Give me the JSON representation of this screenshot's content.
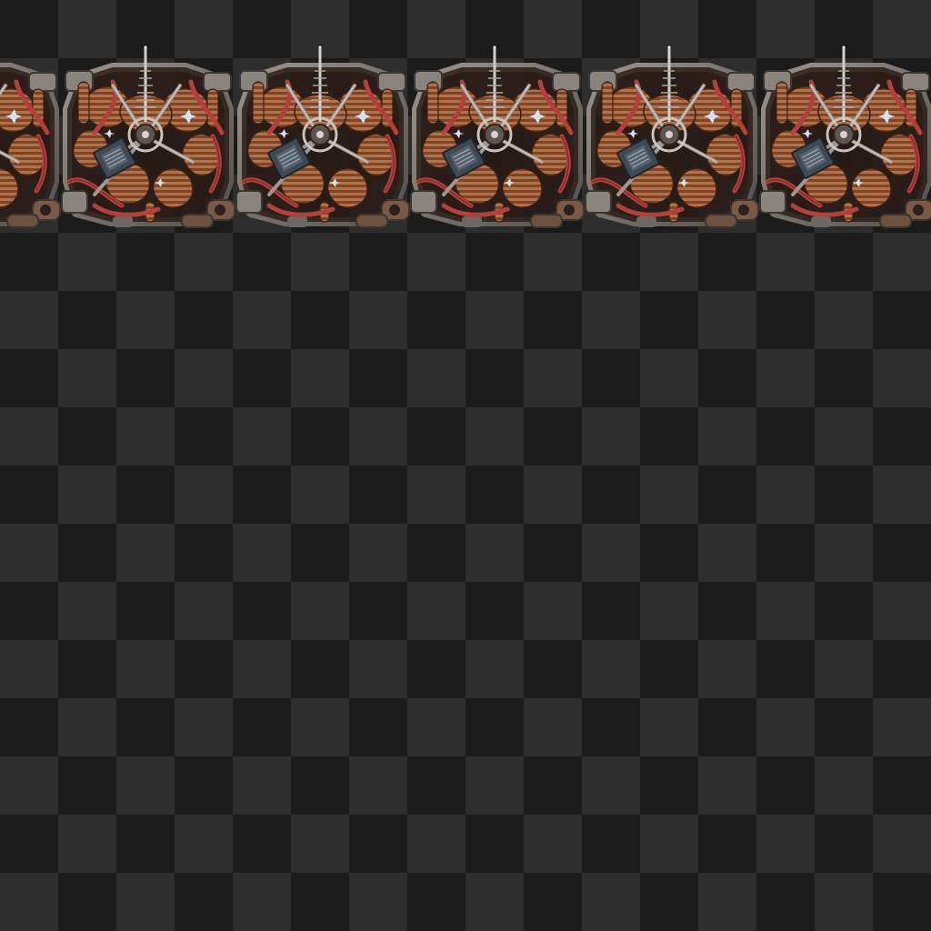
{
  "sheet": {
    "background": "checkerboard",
    "checker_colors": [
      "#1b1b1b",
      "#2d2d2d"
    ],
    "frame_count_visible": 6,
    "first_frame_cropped_left": true
  },
  "sprite": {
    "icon": "machine-core-sprite-icon",
    "palette": {
      "frame": "#7a7470",
      "frame_dark": "#4a4542",
      "coil": "#8a4f2e",
      "coil_light": "#b8784c",
      "cable_red": "#b4403e",
      "chip": "#3d4a55",
      "antenna": "#cfcfcf"
    }
  }
}
